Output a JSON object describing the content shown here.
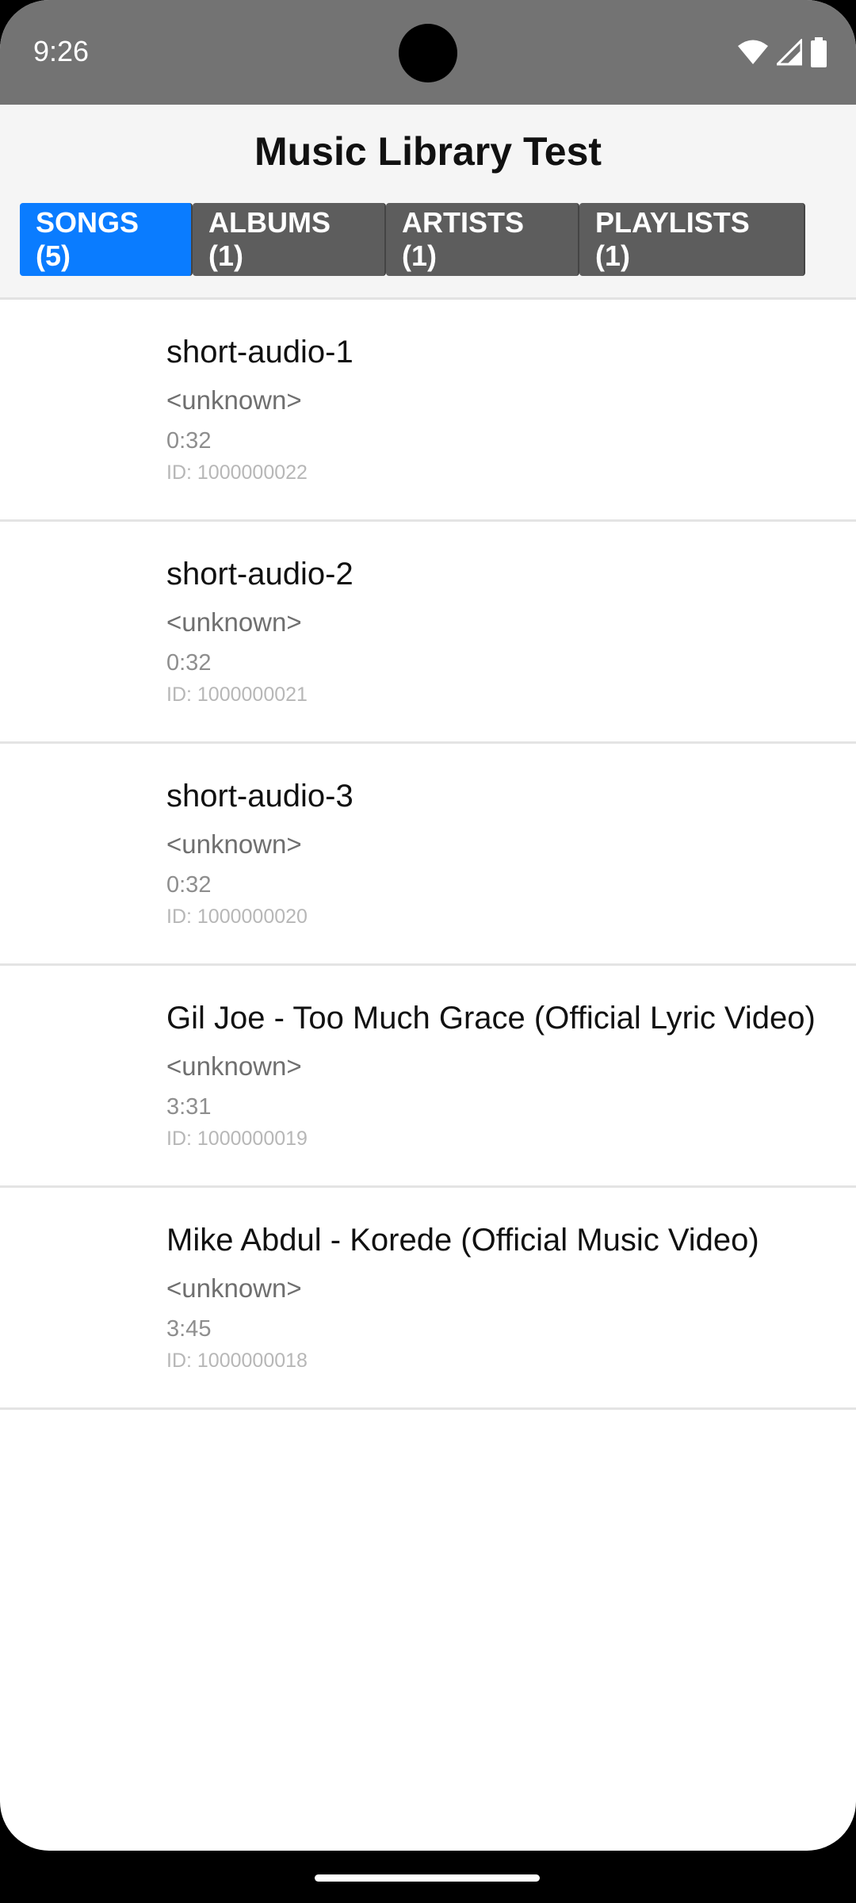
{
  "status_bar": {
    "time": "9:26",
    "icons": [
      "wifi-icon",
      "signal-icon",
      "battery-icon"
    ]
  },
  "app": {
    "title": "Music Library Test"
  },
  "tabs": [
    {
      "label": "SONGS (5)",
      "active": true
    },
    {
      "label": "ALBUMS (1)",
      "active": false
    },
    {
      "label": "ARTISTS (1)",
      "active": false
    },
    {
      "label": "PLAYLISTS (1)",
      "active": false
    }
  ],
  "songs": [
    {
      "title": "short-audio-1",
      "artist": "<unknown>",
      "duration": "0:32",
      "id": "ID: 1000000022"
    },
    {
      "title": "short-audio-2",
      "artist": "<unknown>",
      "duration": "0:32",
      "id": "ID: 1000000021"
    },
    {
      "title": "short-audio-3",
      "artist": "<unknown>",
      "duration": "0:32",
      "id": "ID: 1000000020"
    },
    {
      "title": "Gil Joe - Too Much Grace (Official Lyric Video)",
      "artist": "<unknown>",
      "duration": "3:31",
      "id": "ID: 1000000019"
    },
    {
      "title": "Mike Abdul - Korede (Official Music Video)",
      "artist": "<unknown>",
      "duration": "3:45",
      "id": "ID: 1000000018"
    }
  ],
  "colors": {
    "active_tab": "#0a7cff",
    "inactive_tab": "#5d5d5d",
    "status_bar": "#737373"
  }
}
